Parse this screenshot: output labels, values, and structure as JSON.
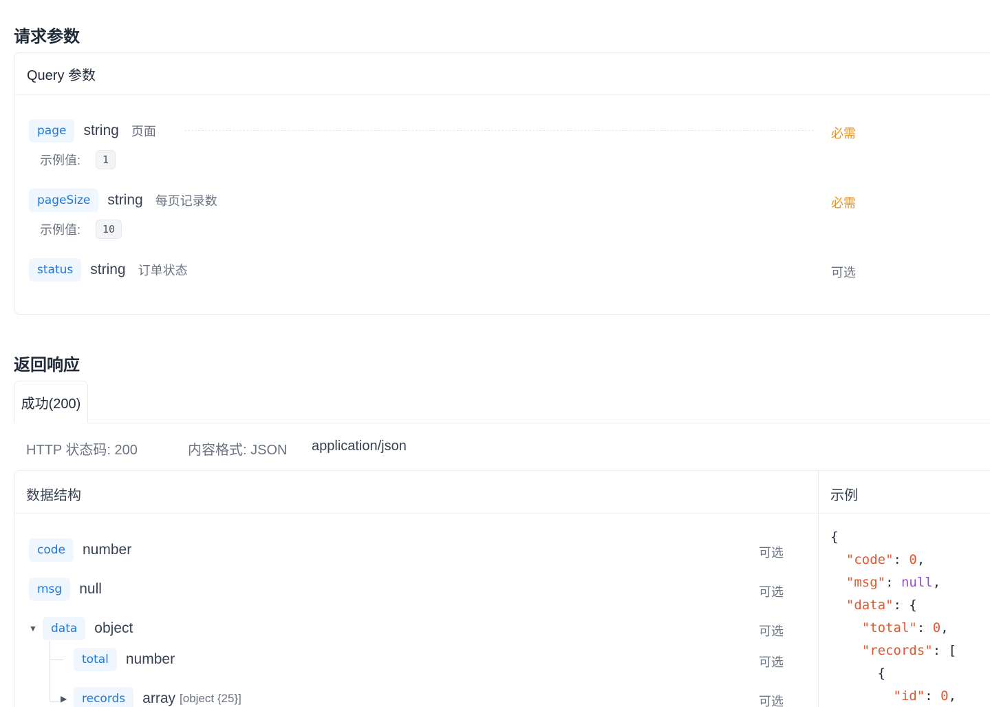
{
  "request": {
    "title": "请求参数",
    "query_header": "Query 参数",
    "example_label": "示例值:",
    "params": [
      {
        "name": "page",
        "type": "string",
        "desc": "页面",
        "flag": "必需",
        "example": "1"
      },
      {
        "name": "pageSize",
        "type": "string",
        "desc": "每页记录数",
        "flag": "必需",
        "example": "10"
      },
      {
        "name": "status",
        "type": "string",
        "desc": "订单状态",
        "flag": "可选"
      }
    ]
  },
  "response": {
    "title": "返回响应",
    "tab_label": "成功(200)",
    "http_status": "HTTP 状态码: 200",
    "content_format": "内容格式: JSON",
    "content_type": "application/json",
    "schema_header": "数据结构",
    "example_header": "示例",
    "fields": [
      {
        "name": "code",
        "type": "number",
        "flag": "可选"
      },
      {
        "name": "msg",
        "type": "null",
        "flag": "可选"
      },
      {
        "name": "data",
        "type": "object",
        "flag": "可选"
      },
      {
        "name": "total",
        "type": "number",
        "flag": "可选"
      },
      {
        "name": "records",
        "type": "array",
        "sub": "[object {25}]",
        "flag": "可选"
      }
    ],
    "example_code": {
      "l1": "{",
      "code_key": "\"code\"",
      "code_val": "0",
      "msg_key": "\"msg\"",
      "msg_val": "null",
      "data_key": "\"data\"",
      "total_key": "\"total\"",
      "total_val": "0",
      "records_key": "\"records\"",
      "obj_open": "{",
      "id_key": "\"id\"",
      "id_val": "0"
    }
  },
  "colors": {
    "param_name": "#1d78dc",
    "required": "#e6921e",
    "json_key": "#e2572e",
    "json_null": "#9b4dca"
  }
}
